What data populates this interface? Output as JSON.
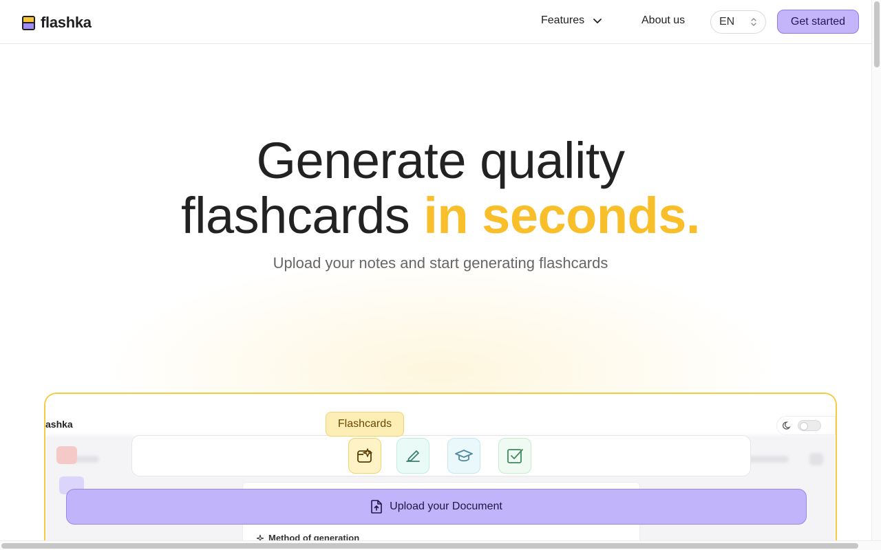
{
  "header": {
    "logo_text": "flashka",
    "nav_features": "Features",
    "nav_about": "About us",
    "lang_value": "EN",
    "cta_label": "Get started"
  },
  "hero": {
    "title_line1": "Generate quality",
    "title_line2_plain": "flashcards ",
    "title_line2_accent": "in seconds.",
    "subtitle": "Upload your notes and start generating flashcards"
  },
  "preview": {
    "logo_text": "ashka",
    "mode_tooltip": "Flashcards",
    "upload_label": "Upload your Document",
    "method_label": "Method of generation"
  },
  "colors": {
    "accent_yellow": "#f8bf2a",
    "cta_purple": "#c4b5fb"
  },
  "icons": {
    "features_chevron": "chevron-down-icon",
    "lang_chevron": "chevron-up-down-icon",
    "mode_flashcards": "sparkle-card-icon",
    "mode_write": "pen-icon",
    "mode_learn": "graduation-cap-icon",
    "mode_quiz": "checkbox-icon",
    "upload": "file-upload-icon",
    "theme": "moon-icon"
  }
}
